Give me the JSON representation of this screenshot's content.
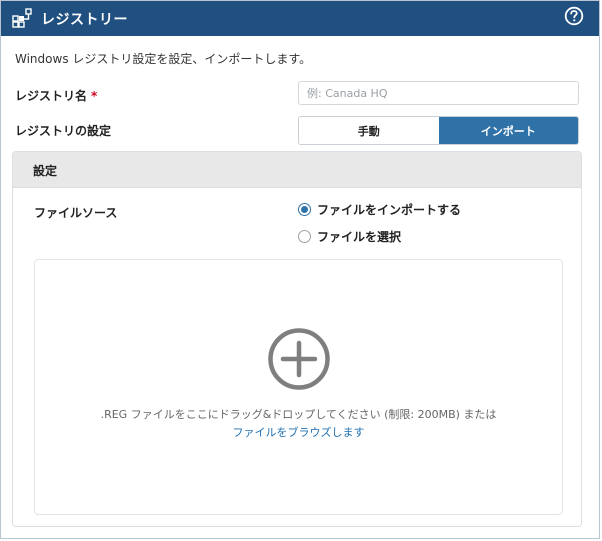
{
  "window": {
    "title": "レジストリー",
    "title_icon": "registry-network-icon",
    "help_icon": "help-circle-icon"
  },
  "description": "Windows レジストリ設定を設定、インポートします。",
  "form": {
    "name_label": "レジストリ名",
    "required_mark": "*",
    "name_placeholder": "例: Canada HQ",
    "name_value": "",
    "settings_label": "レジストリの設定",
    "mode_options": [
      "手動",
      "インポート"
    ],
    "mode_selected": "インポート"
  },
  "panel": {
    "title": "設定",
    "file_source_label": "ファイルソース",
    "radio_options": [
      {
        "label": "ファイルをインポートする",
        "checked": true
      },
      {
        "label": "ファイルを選択",
        "checked": false
      }
    ],
    "dropzone": {
      "icon": "plus-circle-icon",
      "text": ".REG ファイルをここにドラッグ&ドロップしてください (制限: 200MB) または",
      "browse_link": "ファイルをブラウズします"
    }
  },
  "colors": {
    "titlebar": "#20507f",
    "accent": "#2f72a8",
    "link": "#2070b0",
    "required": "#d0021b",
    "panel_header": "#e8e8e8"
  }
}
